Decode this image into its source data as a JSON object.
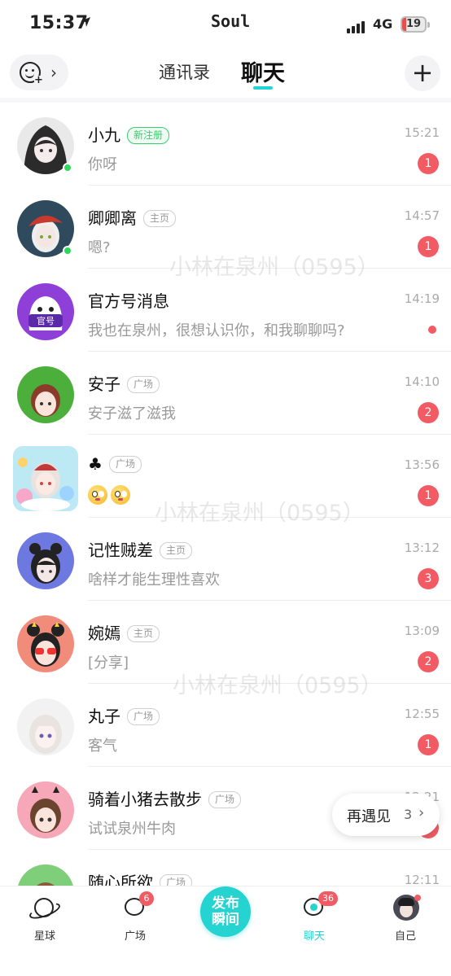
{
  "status_bar": {
    "time": "15:37",
    "app": "Soul",
    "network": "4G",
    "battery": "19"
  },
  "header": {
    "tab_contacts": "通讯录",
    "tab_chat": "聊天",
    "add_symbol": "+"
  },
  "watermark": "小林在泉州（0595）",
  "conversations": [
    {
      "name": "小九",
      "tag": "新注册",
      "message": "你呀",
      "time": "15:21",
      "unread": "1",
      "online": true
    },
    {
      "name": "卿卿离",
      "tag": "主页",
      "message": "嗯?",
      "time": "14:57",
      "unread": "1",
      "online": true
    },
    {
      "name": "官方号消息",
      "tag": "",
      "message": "我也在泉州，很想认识你，和我聊聊吗?",
      "time": "14:19",
      "unread": "",
      "avatar_text": "官号"
    },
    {
      "name": "安子",
      "tag": "广场",
      "message": "安子滋了滋我",
      "time": "14:10",
      "unread": "2"
    },
    {
      "name": "♣",
      "tag": "广场",
      "message": "",
      "time": "13:56",
      "unread": "1"
    },
    {
      "name": "记性贼差",
      "tag": "主页",
      "message": "啥样才能生理性喜欢",
      "time": "13:12",
      "unread": "3"
    },
    {
      "name": "婉嫣",
      "tag": "主页",
      "message": "[分享]",
      "time": "13:09",
      "unread": "2"
    },
    {
      "name": "丸子",
      "tag": "广场",
      "message": "客气",
      "time": "12:55",
      "unread": "1"
    },
    {
      "name": "骑着小猪去散步",
      "tag": "广场",
      "message": "试试泉州牛肉",
      "time": "12:21",
      "unread": "1"
    },
    {
      "name": "随心所欲",
      "tag": "广场",
      "message": "",
      "time": "12:11",
      "unread": ""
    }
  ],
  "reunite": {
    "label": "再遇见",
    "count": "3",
    "chevron": "›"
  },
  "tabbar": {
    "planet": "星球",
    "square": "广场",
    "square_badge": "6",
    "publish": "发布瞬间",
    "chat": "聊天",
    "chat_badge": "36",
    "me": "自己"
  },
  "colors": {
    "accent": "#25d4d0",
    "badge": "#f25b63",
    "online": "#2fd85a",
    "new_tag": "#35cf6e"
  }
}
